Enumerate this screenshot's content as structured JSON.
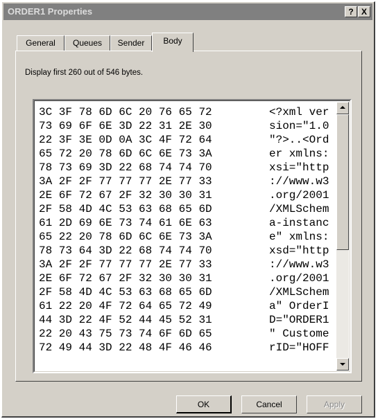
{
  "window": {
    "title": "ORDER1 Properties",
    "help_label": "?",
    "close_label": "X"
  },
  "tabs": [
    {
      "label": "General",
      "active": false
    },
    {
      "label": "Queues",
      "active": false
    },
    {
      "label": "Sender",
      "active": false
    },
    {
      "label": "Body",
      "active": true
    }
  ],
  "body": {
    "display_note": "Display first 260 out of 546 bytes.",
    "lines": [
      {
        "hex": "3C 3F 78 6D 6C 20 76 65 72",
        "ascii": "<?xml ver"
      },
      {
        "hex": "73 69 6F 6E 3D 22 31 2E 30",
        "ascii": "sion=\"1.0"
      },
      {
        "hex": "22 3F 3E 0D 0A 3C 4F 72 64",
        "ascii": "\"?>..<Ord"
      },
      {
        "hex": "65 72 20 78 6D 6C 6E 73 3A",
        "ascii": "er xmlns:"
      },
      {
        "hex": "78 73 69 3D 22 68 74 74 70",
        "ascii": "xsi=\"http"
      },
      {
        "hex": "3A 2F 2F 77 77 77 2E 77 33",
        "ascii": "://www.w3"
      },
      {
        "hex": "2E 6F 72 67 2F 32 30 30 31",
        "ascii": ".org/2001"
      },
      {
        "hex": "2F 58 4D 4C 53 63 68 65 6D",
        "ascii": "/XMLSchem"
      },
      {
        "hex": "61 2D 69 6E 73 74 61 6E 63",
        "ascii": "a-instanc"
      },
      {
        "hex": "65 22 20 78 6D 6C 6E 73 3A",
        "ascii": "e\" xmlns:"
      },
      {
        "hex": "78 73 64 3D 22 68 74 74 70",
        "ascii": "xsd=\"http"
      },
      {
        "hex": "3A 2F 2F 77 77 77 2E 77 33",
        "ascii": "://www.w3"
      },
      {
        "hex": "2E 6F 72 67 2F 32 30 30 31",
        "ascii": ".org/2001"
      },
      {
        "hex": "2F 58 4D 4C 53 63 68 65 6D",
        "ascii": "/XMLSchem"
      },
      {
        "hex": "61 22 20 4F 72 64 65 72 49",
        "ascii": "a\" OrderI"
      },
      {
        "hex": "44 3D 22 4F 52 44 45 52 31",
        "ascii": "D=\"ORDER1"
      },
      {
        "hex": "22 20 43 75 73 74 6F 6D 65",
        "ascii": "\" Custome"
      },
      {
        "hex": "72 49 44 3D 22 48 4F 46 46",
        "ascii": "rID=\"HOFF"
      }
    ]
  },
  "buttons": {
    "ok": "OK",
    "cancel": "Cancel",
    "apply": "Apply",
    "apply_enabled": false
  },
  "icons": {
    "scroll_up": "arrow-up-icon",
    "scroll_down": "arrow-down-icon"
  }
}
